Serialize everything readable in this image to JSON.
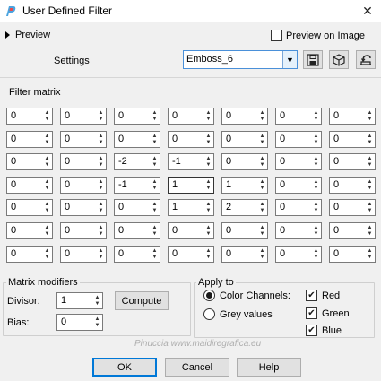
{
  "window": {
    "title": "User Defined Filter"
  },
  "header": {
    "preview_label": "Preview",
    "preview_on_image_label": "Preview on Image",
    "preview_on_image_checked": false,
    "settings_label": "Settings",
    "preset_value": "Emboss_6"
  },
  "matrix": {
    "label": "Filter matrix",
    "rows": [
      [
        "0",
        "0",
        "0",
        "0",
        "0",
        "0",
        "0"
      ],
      [
        "0",
        "0",
        "0",
        "0",
        "0",
        "0",
        "0"
      ],
      [
        "0",
        "0",
        "-2",
        "-1",
        "0",
        "0",
        "0"
      ],
      [
        "0",
        "0",
        "-1",
        "1",
        "1",
        "0",
        "0"
      ],
      [
        "0",
        "0",
        "0",
        "1",
        "2",
        "0",
        "0"
      ],
      [
        "0",
        "0",
        "0",
        "0",
        "0",
        "0",
        "0"
      ],
      [
        "0",
        "0",
        "0",
        "0",
        "0",
        "0",
        "0"
      ]
    ]
  },
  "modifiers": {
    "label": "Matrix modifiers",
    "divisor_label": "Divisor:",
    "divisor_value": "1",
    "compute_label": "Compute",
    "bias_label": "Bias:",
    "bias_value": "0"
  },
  "apply": {
    "label": "Apply to",
    "color_channels_label": "Color Channels:",
    "grey_values_label": "Grey values",
    "selected": "color_channels",
    "red_label": "Red",
    "green_label": "Green",
    "blue_label": "Blue",
    "red_checked": true,
    "green_checked": true,
    "blue_checked": true
  },
  "footer": {
    "ok_label": "OK",
    "cancel_label": "Cancel",
    "help_label": "Help"
  },
  "watermark": "Pinuccia www.maidiregrafica.eu",
  "colors": {
    "accent": "#0078d7",
    "combo_border": "#4a90d9",
    "background": "#f0f0f0"
  }
}
